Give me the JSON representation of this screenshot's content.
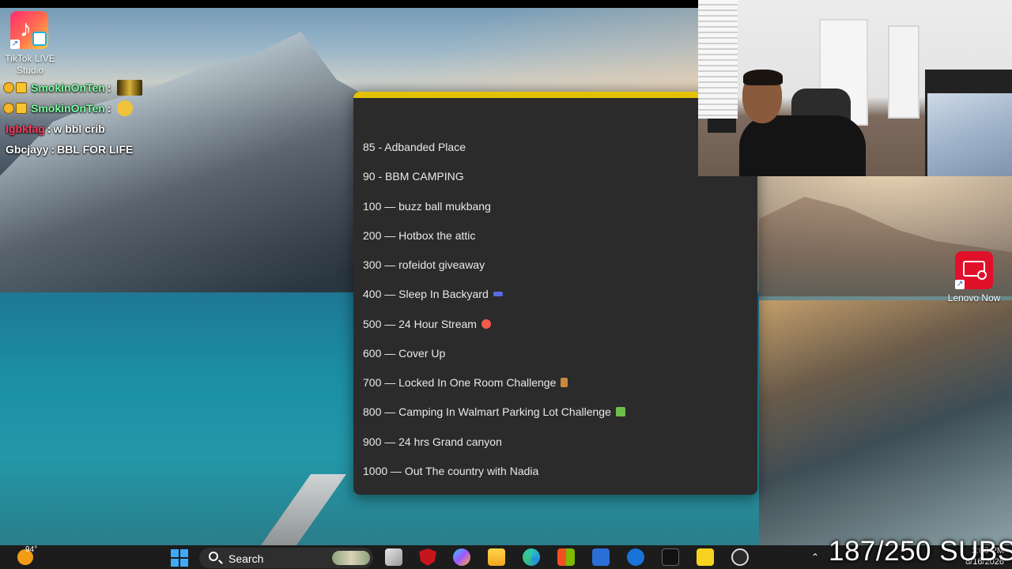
{
  "desktop": {
    "tiktok_label": "TikTok LIVE Studio",
    "lenovo_label": "Lenovo Now"
  },
  "chat": [
    {
      "user": "SmokinOnTen",
      "sep": ":",
      "message": "",
      "user_color": "#7dffa5"
    },
    {
      "user": "SmokinOnTen",
      "sep": ":",
      "message": "",
      "user_color": "#7dffa5"
    },
    {
      "user": "lgbkfag",
      "sep": ":",
      "message": "w bbl crib",
      "user_color": "#ff3b5c"
    },
    {
      "user": "Gbcjayy",
      "sep": ":",
      "message": "BBL FOR LIFE",
      "user_color": "#ffffff"
    }
  ],
  "goals": [
    "85 -  Adbanded Place",
    "90 - BBM CAMPING",
    "100 — buzz ball mukbang",
    "200 — Hotbox the attic",
    "300 — rofeidot giveaway",
    "400 — Sleep In Backyard",
    "500 — 24 Hour Stream",
    "600 — Cover Up",
    "700 — Locked In One Room Challenge",
    "800 — Camping In Walmart Parking Lot Challenge",
    "900 — 24 hrs Grand canyon",
    "1000 — Out The country with Nadia"
  ],
  "panel_accent": "#e2c200",
  "taskbar": {
    "weather_temp": "94°",
    "search_placeholder": "Search",
    "date": "8/16/2026",
    "time": "2:08 PM"
  },
  "overlay": {
    "subs_text": "187/250 SUBS"
  }
}
